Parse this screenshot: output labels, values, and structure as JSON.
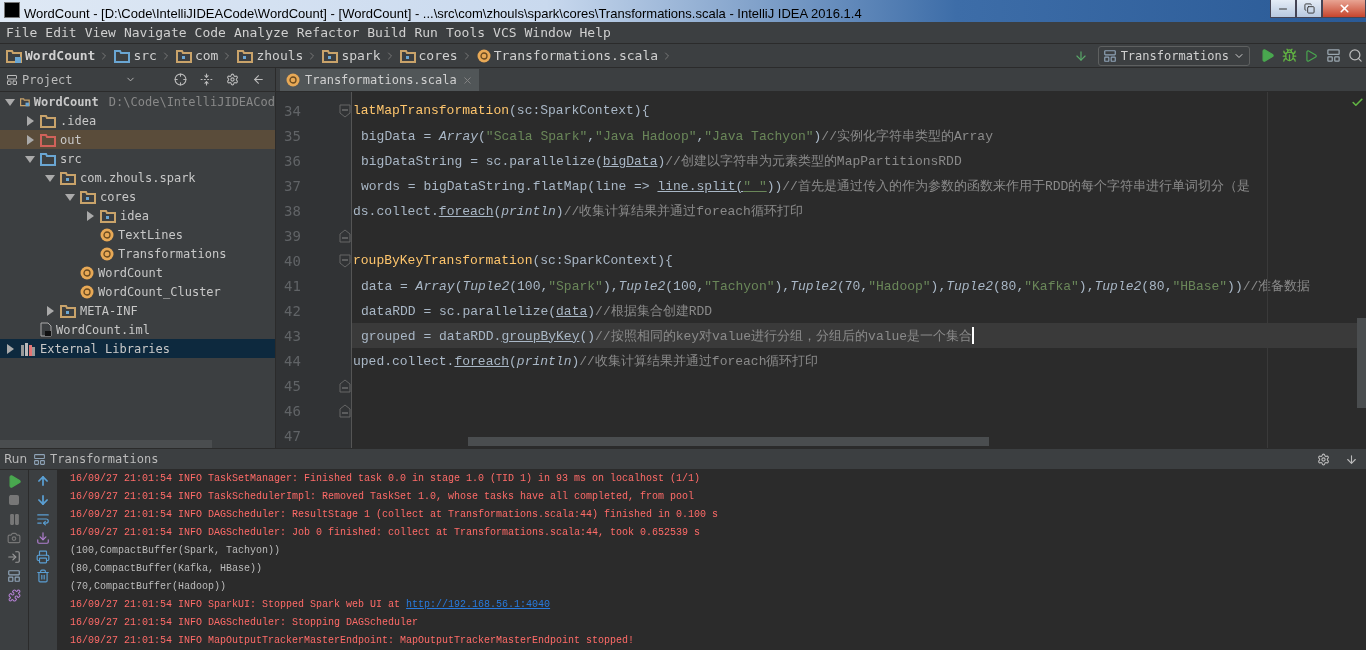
{
  "window": {
    "title": "WordCount - [D:\\Code\\IntelliJIDEACode\\WordCount] - [WordCount] - ...\\src\\com\\zhouls\\spark\\cores\\Transformations.scala - IntelliJ IDEA 2016.1.4"
  },
  "menu": [
    "File",
    "Edit",
    "View",
    "Navigate",
    "Code",
    "Analyze",
    "Refactor",
    "Build",
    "Run",
    "Tools",
    "VCS",
    "Window",
    "Help"
  ],
  "breadcrumb": [
    {
      "label": "WordCount",
      "kind": "module"
    },
    {
      "label": "src",
      "kind": "source"
    },
    {
      "label": "com",
      "kind": "package"
    },
    {
      "label": "zhouls",
      "kind": "package"
    },
    {
      "label": "spark",
      "kind": "package"
    },
    {
      "label": "cores",
      "kind": "package"
    },
    {
      "label": "Transformations.scala",
      "kind": "class"
    }
  ],
  "run_config": {
    "label": "Transformations"
  },
  "project_panel": {
    "title": "Project",
    "tree": [
      {
        "label": "WordCount",
        "kind": "module",
        "path": "D:\\Code\\IntelliJIDEACod",
        "expanded": true,
        "selected": false,
        "highlighted": false,
        "children": [
          {
            "label": ".idea",
            "kind": "folder",
            "expanded": false,
            "selected": false,
            "highlighted": false
          },
          {
            "label": "out",
            "kind": "excluded",
            "expanded": false,
            "selected": false,
            "highlighted": true
          },
          {
            "label": "src",
            "kind": "source",
            "expanded": true,
            "selected": false,
            "highlighted": false,
            "children": [
              {
                "label": "com.zhouls.spark",
                "kind": "package",
                "expanded": true,
                "selected": false,
                "highlighted": false,
                "children": [
                  {
                    "label": "cores",
                    "kind": "package",
                    "expanded": true,
                    "selected": false,
                    "highlighted": false,
                    "children": [
                      {
                        "label": "idea",
                        "kind": "package",
                        "expanded": false,
                        "selected": false,
                        "highlighted": false
                      },
                      {
                        "label": "TextLines",
                        "kind": "class",
                        "selected": false,
                        "highlighted": false
                      },
                      {
                        "label": "Transformations",
                        "kind": "class",
                        "selected": false,
                        "highlighted": false
                      }
                    ]
                  },
                  {
                    "label": "WordCount",
                    "kind": "class",
                    "selected": false,
                    "highlighted": false
                  },
                  {
                    "label": "WordCount_Cluster",
                    "kind": "class",
                    "selected": false,
                    "highlighted": false
                  }
                ]
              },
              {
                "label": "META-INF",
                "kind": "package",
                "expanded": false,
                "selected": false,
                "highlighted": false
              }
            ]
          },
          {
            "label": "WordCount.iml",
            "kind": "file",
            "selected": false,
            "highlighted": false
          }
        ]
      },
      {
        "label": "External Libraries",
        "kind": "library",
        "expanded": false,
        "selected": true,
        "highlighted": false
      }
    ]
  },
  "editor": {
    "tabs": [
      {
        "label": "Transformations.scala",
        "selected": true
      }
    ],
    "lines": [
      {
        "number": "34",
        "fold_start": true,
        "fold_end": false,
        "indented": false,
        "current": false,
        "caret": false,
        "tokens": [
          {
            "kind": "decl",
            "text": "latMapTransformation"
          },
          {
            "kind": "plain",
            "text": "(sc:SparkContext){"
          }
        ]
      },
      {
        "number": "35",
        "fold_start": false,
        "fold_end": false,
        "indented": true,
        "current": false,
        "caret": false,
        "tokens": [
          {
            "kind": "plain",
            "text": "bigData = "
          },
          {
            "kind": "italic",
            "text": "Array"
          },
          {
            "kind": "plain",
            "text": "("
          },
          {
            "kind": "string",
            "text": "\"Scala Spark\""
          },
          {
            "kind": "plain",
            "text": ","
          },
          {
            "kind": "string",
            "text": "\"Java Hadoop\""
          },
          {
            "kind": "plain",
            "text": ","
          },
          {
            "kind": "string",
            "text": "\"Java Tachyon\""
          },
          {
            "kind": "plain",
            "text": ")"
          },
          {
            "kind": "comment",
            "text": "//实例化字符串类型的Array"
          }
        ]
      },
      {
        "number": "36",
        "fold_start": false,
        "fold_end": false,
        "indented": true,
        "current": false,
        "caret": false,
        "tokens": [
          {
            "kind": "plain",
            "text": "bigDataString = sc.parallelize("
          },
          {
            "kind": "link",
            "text": "bigData"
          },
          {
            "kind": "plain",
            "text": ")"
          },
          {
            "kind": "comment",
            "text": "//创建以字符串为元素类型的MapPartitionsRDD"
          }
        ]
      },
      {
        "number": "37",
        "fold_start": false,
        "fold_end": false,
        "indented": true,
        "current": false,
        "caret": false,
        "tokens": [
          {
            "kind": "plain",
            "text": "words = bigDataString.flatMap(line => "
          },
          {
            "kind": "link",
            "text": "line.split("
          },
          {
            "kind": "link-string",
            "text": "\" \""
          },
          {
            "kind": "plain",
            "text": "))"
          },
          {
            "kind": "comment",
            "text": "//首先是通过传入的作为参数的函数来作用于RDD的每个字符串进行单词切分（是"
          }
        ]
      },
      {
        "number": "38",
        "fold_start": false,
        "fold_end": false,
        "indented": false,
        "current": false,
        "caret": false,
        "tokens": [
          {
            "kind": "plain",
            "text": "ds.collect."
          },
          {
            "kind": "link",
            "text": "foreach"
          },
          {
            "kind": "plain",
            "text": "("
          },
          {
            "kind": "italic",
            "text": "println"
          },
          {
            "kind": "plain",
            "text": ")"
          },
          {
            "kind": "comment",
            "text": "//收集计算结果并通过foreach循环打印"
          }
        ]
      },
      {
        "number": "39",
        "fold_start": false,
        "fold_end": true,
        "current": false,
        "caret": false
      },
      {
        "number": "40",
        "fold_start": true,
        "fold_end": false,
        "indented": false,
        "current": false,
        "caret": false,
        "tokens": [
          {
            "kind": "decl",
            "text": "roupByKeyTransformation"
          },
          {
            "kind": "plain",
            "text": "(sc:SparkContext){"
          }
        ]
      },
      {
        "number": "41",
        "fold_start": false,
        "fold_end": false,
        "indented": true,
        "current": false,
        "caret": false,
        "tokens": [
          {
            "kind": "plain",
            "text": "data = "
          },
          {
            "kind": "italic",
            "text": "Array"
          },
          {
            "kind": "plain",
            "text": "("
          },
          {
            "kind": "italic",
            "text": "Tuple2"
          },
          {
            "kind": "plain",
            "text": "(100,"
          },
          {
            "kind": "string",
            "text": "\"Spark\""
          },
          {
            "kind": "plain",
            "text": "),"
          },
          {
            "kind": "italic",
            "text": "Tuple2"
          },
          {
            "kind": "plain",
            "text": "(100,"
          },
          {
            "kind": "string",
            "text": "\"Tachyon\""
          },
          {
            "kind": "plain",
            "text": "),"
          },
          {
            "kind": "italic",
            "text": "Tuple2"
          },
          {
            "kind": "plain",
            "text": "(70,"
          },
          {
            "kind": "string",
            "text": "\"Hadoop\""
          },
          {
            "kind": "plain",
            "text": "),"
          },
          {
            "kind": "italic",
            "text": "Tuple2"
          },
          {
            "kind": "plain",
            "text": "(80,"
          },
          {
            "kind": "string",
            "text": "\"Kafka\""
          },
          {
            "kind": "plain",
            "text": "),"
          },
          {
            "kind": "italic",
            "text": "Tuple2"
          },
          {
            "kind": "plain",
            "text": "(80,"
          },
          {
            "kind": "string",
            "text": "\"HBase\""
          },
          {
            "kind": "plain",
            "text": "))"
          },
          {
            "kind": "comment",
            "text": "//准备数据"
          }
        ]
      },
      {
        "number": "42",
        "fold_start": false,
        "fold_end": false,
        "indented": true,
        "current": false,
        "caret": false,
        "tokens": [
          {
            "kind": "plain",
            "text": "dataRDD = sc.parallelize("
          },
          {
            "kind": "link",
            "text": "data"
          },
          {
            "kind": "plain",
            "text": ")"
          },
          {
            "kind": "comment",
            "text": "//根据集合创建RDD"
          }
        ]
      },
      {
        "number": "43",
        "fold_start": false,
        "fold_end": false,
        "indented": true,
        "current": true,
        "caret": true,
        "tokens": [
          {
            "kind": "plain",
            "text": "grouped = dataRDD."
          },
          {
            "kind": "link",
            "text": "groupByKey"
          },
          {
            "kind": "plain",
            "text": "()"
          },
          {
            "kind": "comment",
            "text": "//按照相同的key对value进行分组，分组后的value是一个集合"
          }
        ]
      },
      {
        "number": "44",
        "fold_start": false,
        "fold_end": false,
        "indented": false,
        "current": false,
        "caret": false,
        "tokens": [
          {
            "kind": "plain",
            "text": "uped.collect."
          },
          {
            "kind": "link",
            "text": "foreach"
          },
          {
            "kind": "plain",
            "text": "("
          },
          {
            "kind": "italic",
            "text": "println"
          },
          {
            "kind": "plain",
            "text": ")"
          },
          {
            "kind": "comment",
            "text": "//收集计算结果并通过foreach循环打印"
          }
        ]
      },
      {
        "number": "45",
        "fold_start": false,
        "fold_end": true,
        "current": false,
        "caret": false
      },
      {
        "number": "46",
        "fold_start": false,
        "fold_end": true,
        "current": false,
        "caret": false
      },
      {
        "number": "47",
        "fold_start": false,
        "fold_end": false,
        "current": false,
        "caret": false
      }
    ]
  },
  "run_panel": {
    "title": "Run",
    "tab": "Transformations",
    "console": [
      {
        "kind": "err",
        "text": "16/09/27 21:01:54 INFO TaskSetManager: Finished task 0.0 in stage 1.0 (TID 1) in 93 ms on localhost (1/1)"
      },
      {
        "kind": "err",
        "text": "16/09/27 21:01:54 INFO TaskSchedulerImpl: Removed TaskSet 1.0, whose tasks have all completed, from pool"
      },
      {
        "kind": "err",
        "text": "16/09/27 21:01:54 INFO DAGScheduler: ResultStage 1 (collect at Transformations.scala:44) finished in 0.100 s"
      },
      {
        "kind": "err",
        "text": "16/09/27 21:01:54 INFO DAGScheduler: Job 0 finished: collect at Transformations.scala:44, took 0.652539 s"
      },
      {
        "kind": "out",
        "text": "(100,CompactBuffer(Spark, Tachyon))"
      },
      {
        "kind": "out",
        "text": "(80,CompactBuffer(Kafka, HBase))"
      },
      {
        "kind": "out",
        "text": "(70,CompactBuffer(Hadoop))"
      },
      {
        "kind": "err",
        "text": "16/09/27 21:01:54 INFO SparkUI: Stopped Spark web UI at ",
        "link": "http://192.168.56.1:4040"
      },
      {
        "kind": "err",
        "text": "16/09/27 21:01:54 INFO DAGScheduler: Stopping DAGScheduler"
      },
      {
        "kind": "err",
        "text": "16/09/27 21:01:54 INFO MapOutputTrackerMasterEndpoint: MapOutputTrackerMasterEndpoint stopped!"
      }
    ]
  }
}
